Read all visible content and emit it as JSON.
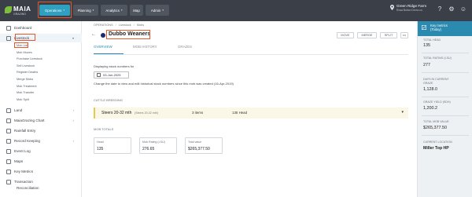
{
  "app": {
    "brand": "MAIA",
    "brand_sub": "GRAZING"
  },
  "topnav": {
    "items": [
      {
        "label": "Operations",
        "active": true
      },
      {
        "label": "Planning",
        "active": false
      },
      {
        "label": "Analytics",
        "active": false
      },
      {
        "label": "Map",
        "active": false
      },
      {
        "label": "Admin",
        "active": false
      }
    ],
    "farm_name": "Green Ridge Farm",
    "farm_sub": "Rosa Bolton Demo co"
  },
  "sidebar": {
    "items": [
      {
        "label": "Dashboard"
      },
      {
        "label": "Livestock"
      },
      {
        "label": "Land"
      },
      {
        "label": "MaiaGrazing Chart"
      },
      {
        "label": "Rainfall Entry"
      },
      {
        "label": "Record Keeping"
      },
      {
        "label": "Event Log"
      },
      {
        "label": "Maps"
      },
      {
        "label": "Key Metrics"
      },
      {
        "label": "Transaction"
      },
      {
        "label": "Reconciliation"
      }
    ],
    "livestock_sub": [
      "Mob List",
      "Mob Moves",
      "Purchase Livestock",
      "Sell Livestock",
      "Register Deaths",
      "Merge Mobs",
      "Mob Treatment",
      "Mob Transfer",
      "Mob Split"
    ]
  },
  "breadcrumb": {
    "items": [
      "OPERATIONS",
      "Livestock",
      "Mobs"
    ]
  },
  "mob": {
    "title": "Dubbo Weaners",
    "actions": [
      "MOVE",
      "MERGE",
      "SPLIT",
      "•••"
    ],
    "tabs": [
      "OVERVIEW",
      "MOB HISTORY",
      "GRAZES"
    ],
    "display_label": "Displaying stock numbers for",
    "date": "03-Jun-2025",
    "change_text": "Change the date to view and edit historical stock numbers since this mob was created (16-Apr-2019)",
    "cattle_section": "CATTLE BREEDING",
    "cattle_row": {
      "name": "Steers 20-32 mth",
      "sub": "(Steers 20-32 mth)",
      "items": "3 items",
      "head": "135",
      "head_unit": "Head"
    },
    "totals_section": "MOB TOTALS",
    "totals": [
      {
        "key": "Head",
        "value": "135"
      },
      {
        "key": "Mob Rating (LSU)",
        "value": "276.65"
      },
      {
        "key": "Total value",
        "value": "$265,377.50"
      }
    ]
  },
  "metrics": {
    "header_title": "Key metrics",
    "header_sub": "(Today)",
    "items": [
      {
        "label": "TOTAL HEAD",
        "value": "135"
      },
      {
        "label": "TOTAL RATING (LSU)",
        "value": "277"
      },
      {
        "label": "DAYS IN CURRENT GRAZE",
        "value": "1,128.0"
      },
      {
        "label": "GRAZE YIELD (SDH)",
        "value": "1,200.2"
      },
      {
        "label": "TOTAL MOB VALUE",
        "value": "$265,377.50"
      },
      {
        "label": "CURRENT LOCATION",
        "value": "Miller Top HP"
      }
    ]
  },
  "colors": {
    "topbar": "#3a3f48",
    "accent": "#2a8ab0",
    "highlight": "#e8572a",
    "mob_dot": "#1c2c6b",
    "cattle_bar": "#e8c84a"
  }
}
